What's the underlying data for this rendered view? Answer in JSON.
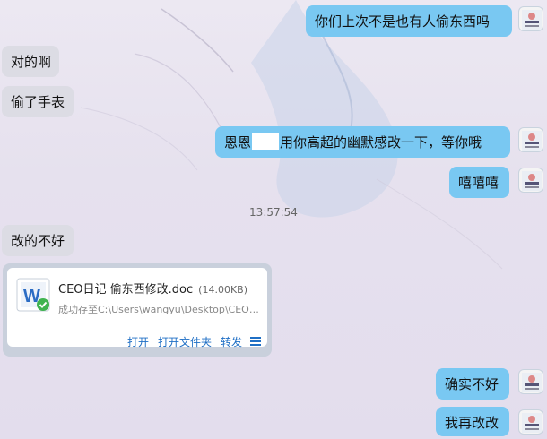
{
  "messages": [
    {
      "side": "out",
      "text": "你们上次不是也有人偷东西吗"
    },
    {
      "side": "in",
      "text": "对的啊"
    },
    {
      "side": "in",
      "text": "偷了手表"
    },
    {
      "side": "out",
      "text_pre": "恩恩",
      "text_post": "用你高超的幽默感改一下，等你哦"
    },
    {
      "side": "out",
      "text": "嘻嘻嘻"
    },
    {
      "side": "in",
      "text": "改的不好"
    },
    {
      "side": "out",
      "text": "确实不好"
    },
    {
      "side": "out",
      "text": "我再改改"
    }
  ],
  "timestamp": "13:57:54",
  "file": {
    "name": "CEO日记 偷东西修改.doc",
    "size": "(14.00KB)",
    "status": "成功存至C:\\Users\\wangyu\\Desktop\\CEO日...",
    "icon": "word-doc-icon",
    "actions": {
      "open": "打开",
      "open_folder": "打开文件夹",
      "forward": "转发"
    }
  },
  "colors": {
    "incoming": "#dcdce4",
    "outgoing": "#79c8f2",
    "link": "#1f6fc5"
  }
}
